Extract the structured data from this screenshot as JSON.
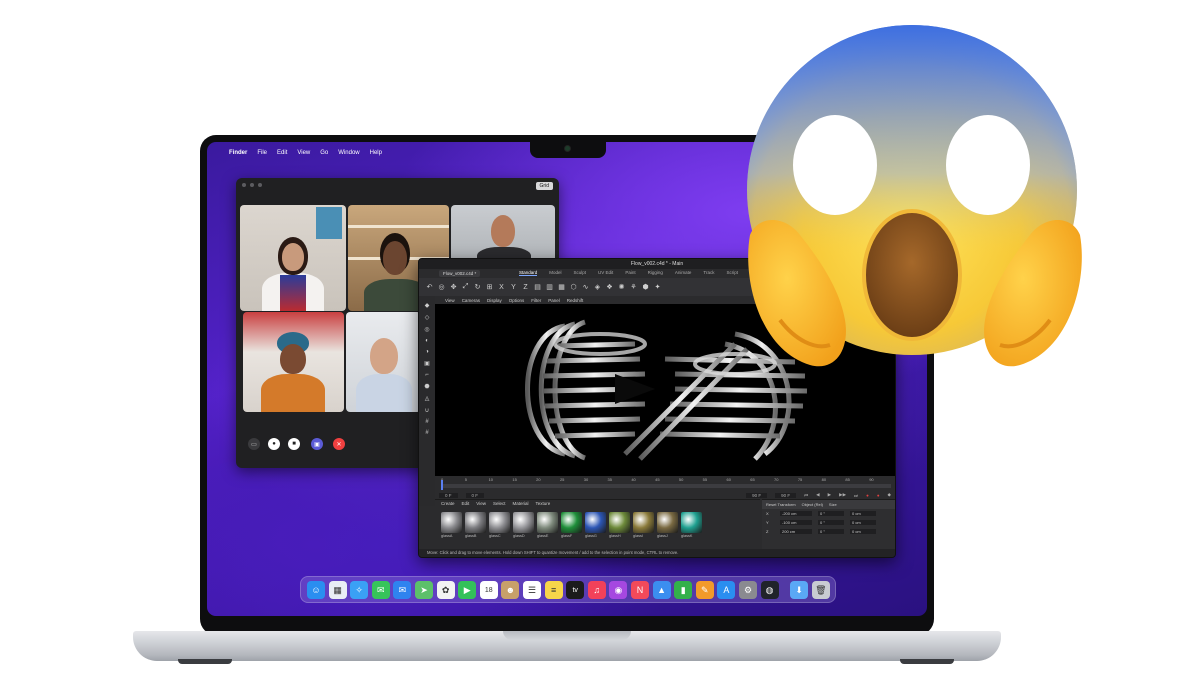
{
  "menubar": {
    "apple_glyph": "",
    "app_name": "Finder",
    "items": [
      "File",
      "Edit",
      "View",
      "Go",
      "Window",
      "Help"
    ]
  },
  "facetime": {
    "grid_button": "Grid",
    "controls": [
      "sidebar-toggle",
      "microphone",
      "camera",
      "share-screen",
      "end-call"
    ]
  },
  "c4d": {
    "title": "Flow_v002.c4d * - Main",
    "doc_tab": "Flow_v002.c4d *",
    "layouts": [
      "Standard",
      "Model",
      "Sculpt",
      "UV Edit",
      "Paint",
      "Rigging",
      "Animate",
      "Track",
      "Script"
    ],
    "active_layout": "Standard",
    "viewport_menu": [
      "View",
      "Cameras",
      "Display",
      "Options",
      "Filter",
      "Panel",
      "Redshift"
    ],
    "timeline_ticks": [
      "0",
      "5",
      "10",
      "15",
      "20",
      "25",
      "30",
      "35",
      "40",
      "45",
      "50",
      "55",
      "60",
      "65",
      "70",
      "75",
      "80",
      "85",
      "90"
    ],
    "timeline_fields": {
      "start": "0 F",
      "current": "0 F",
      "end": "90 F",
      "end2": "90 F"
    },
    "material_menu": [
      "Create",
      "Edit",
      "View",
      "Select",
      "Material",
      "Texture"
    ],
    "materials": [
      {
        "name": "glassA",
        "color": "#8a8a8e"
      },
      {
        "name": "glassB",
        "color": "#7c7c80"
      },
      {
        "name": "glassC",
        "color": "#8e8e92"
      },
      {
        "name": "glassD",
        "color": "#96969a"
      },
      {
        "name": "glassE",
        "color": "#7e8a7c"
      },
      {
        "name": "glassF",
        "color": "#1f8f3a"
      },
      {
        "name": "glassG",
        "color": "#2c56b5"
      },
      {
        "name": "glassH",
        "color": "#6d8a3a"
      },
      {
        "name": "glassI",
        "color": "#8a7a3a"
      },
      {
        "name": "glassJ",
        "color": "#7a6a42"
      },
      {
        "name": "glassK",
        "color": "#1fa090"
      }
    ],
    "attributes": {
      "header": [
        "Reset Transform",
        "Object (Rel)",
        "Size"
      ],
      "rows": [
        {
          "axis": "X",
          "pos": "-200 cm",
          "rot": "0 °",
          "size": "0 cm"
        },
        {
          "axis": "Y",
          "pos": "-100 cm",
          "rot": "0 °",
          "size": "0 cm"
        },
        {
          "axis": "Z",
          "pos": "200 cm",
          "rot": "0 °",
          "size": "0 cm"
        }
      ]
    },
    "status": "Move: Click and drag to move elements. Hold down SHIFT to quantize movement / add to the selection in point mode, CTRL to remove."
  },
  "dock": {
    "apps": [
      {
        "name": "finder-icon",
        "color": "#2a8ef0",
        "glyph": "☺"
      },
      {
        "name": "launchpad-icon",
        "color": "#e9eef5",
        "glyph": "▦"
      },
      {
        "name": "safari-icon",
        "color": "#3aa0f5",
        "glyph": "✧"
      },
      {
        "name": "messages-icon",
        "color": "#36c45a",
        "glyph": "✉"
      },
      {
        "name": "mail-icon",
        "color": "#2f83ef",
        "glyph": "✉"
      },
      {
        "name": "maps-icon",
        "color": "#5cc06a",
        "glyph": "➤"
      },
      {
        "name": "photos-icon",
        "color": "#f3f3f3",
        "glyph": "✿"
      },
      {
        "name": "facetime-icon",
        "color": "#33c15a",
        "glyph": "▶"
      },
      {
        "name": "calendar-icon",
        "color": "#ffffff",
        "glyph": "18"
      },
      {
        "name": "contacts-icon",
        "color": "#c8a06a",
        "glyph": "☻"
      },
      {
        "name": "reminders-icon",
        "color": "#ffffff",
        "glyph": "☰"
      },
      {
        "name": "notes-icon",
        "color": "#f7d54a",
        "glyph": "≡"
      },
      {
        "name": "tv-icon",
        "color": "#1b1b1b",
        "glyph": "tv"
      },
      {
        "name": "music-icon",
        "color": "#f2415a",
        "glyph": "♫"
      },
      {
        "name": "podcasts-icon",
        "color": "#a548e0",
        "glyph": "◉"
      },
      {
        "name": "news-icon",
        "color": "#f24a5a",
        "glyph": "N"
      },
      {
        "name": "keynote-icon",
        "color": "#3b8ef0",
        "glyph": "▲"
      },
      {
        "name": "numbers-icon",
        "color": "#33b04a",
        "glyph": "▮"
      },
      {
        "name": "pages-icon",
        "color": "#f29a2a",
        "glyph": "✎"
      },
      {
        "name": "app-store-icon",
        "color": "#2a8ef0",
        "glyph": "A"
      },
      {
        "name": "system-preferences-icon",
        "color": "#8a8a90",
        "glyph": "⚙"
      },
      {
        "name": "cinema4d-icon",
        "color": "#20232a",
        "glyph": "◍"
      },
      {
        "name": "downloads-icon",
        "color": "#5aa8f5",
        "glyph": "⬇"
      },
      {
        "name": "trash-icon",
        "color": "#c9ccd2",
        "glyph": "🗑"
      }
    ]
  },
  "overlay": {
    "emoji_name": "face-screaming-in-fear-icon"
  }
}
